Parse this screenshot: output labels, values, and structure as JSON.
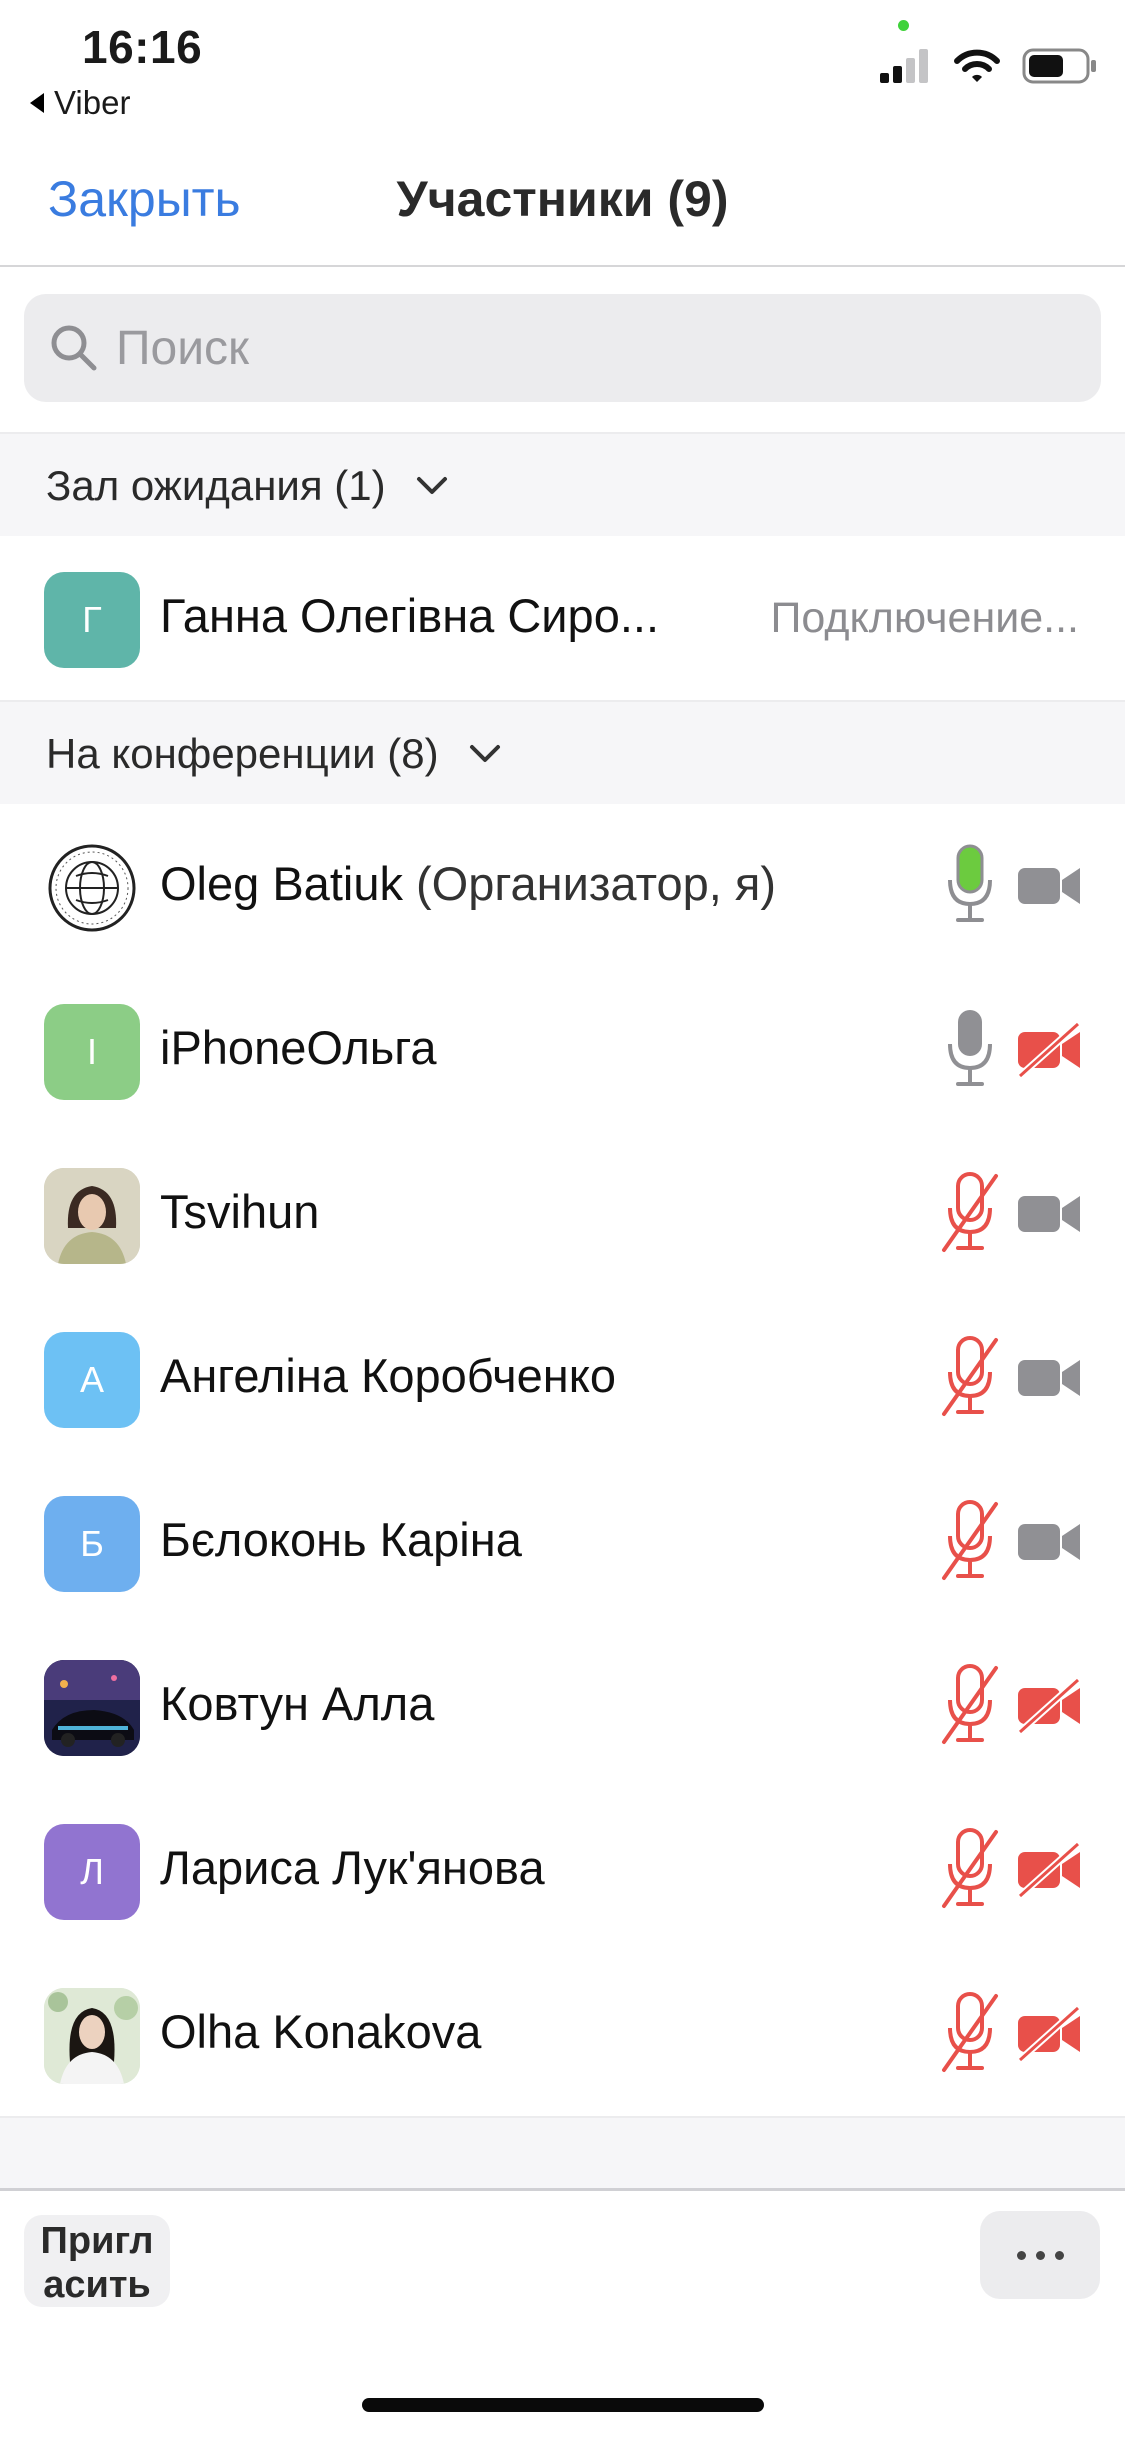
{
  "status_bar": {
    "time": "16:16",
    "back_app": "Viber",
    "icons": [
      "signal-icon",
      "wifi-icon",
      "battery-icon"
    ]
  },
  "header": {
    "close_label": "Закрыть",
    "title": "Участники (9)"
  },
  "search": {
    "placeholder": "Поиск"
  },
  "waiting_room": {
    "label": "Зал ожидания (1)",
    "participants": [
      {
        "name": "Ганна Олегівна Сиро...",
        "initial": "Г",
        "status": "Подключение..."
      }
    ]
  },
  "in_meeting": {
    "label": "На конференции (8)",
    "participants": [
      {
        "name": "Oleg Batiuk",
        "role": "(Организатор, я)",
        "avatar": "logo",
        "mic": "active",
        "cam": "on"
      },
      {
        "name": "iPhoneОльга",
        "initial": "I",
        "mic": "on",
        "cam": "off"
      },
      {
        "name": "Tsvihun",
        "avatar": "photo",
        "mic": "muted",
        "cam": "on"
      },
      {
        "name": "Ангеліна Коробченко",
        "initial": "А",
        "mic": "muted",
        "cam": "on"
      },
      {
        "name": "Бєлоконь Каріна",
        "initial": "Б",
        "mic": "muted",
        "cam": "on"
      },
      {
        "name": "Ковтун Алла",
        "avatar": "photo",
        "mic": "muted",
        "cam": "off"
      },
      {
        "name": "Лариса Лук'янова",
        "initial": "Л",
        "mic": "muted",
        "cam": "off"
      },
      {
        "name": "Olha Konakova",
        "avatar": "photo",
        "mic": "muted",
        "cam": "off"
      }
    ]
  },
  "bottom": {
    "invite_line1": "Пригл",
    "invite_line2": "асить",
    "more_icon": "more-icon"
  },
  "colors": {
    "accent": "#3a7ce0",
    "muted_red": "#e8504a",
    "mic_active": "#6ccb3f",
    "icon_gray": "#909094",
    "avatar_teal": "#5fb5a9",
    "avatar_green": "#8ccd86",
    "avatar_lightblue": "#6dc1f4",
    "avatar_blue": "#6eafef",
    "avatar_purple": "#9174d0"
  }
}
